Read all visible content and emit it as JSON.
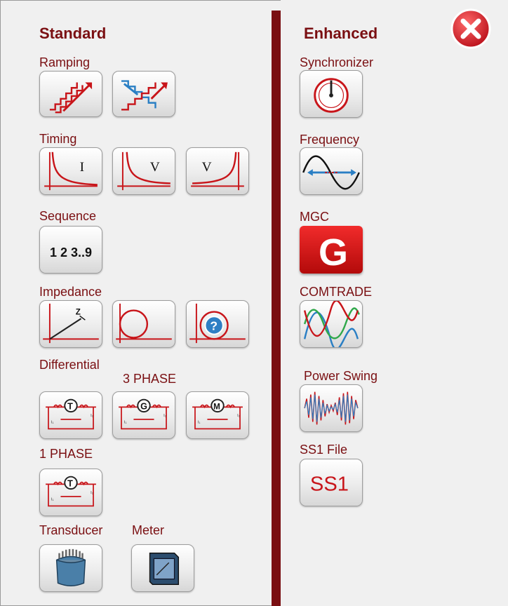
{
  "standard": {
    "heading": "Standard",
    "ramping": {
      "label": "Ramping",
      "buttons": [
        "ramp-up-icon",
        "ramp-pulse-icon"
      ]
    },
    "timing": {
      "label": "Timing",
      "buttons": [
        {
          "icon": "timing-current-curve-icon",
          "letter": "I"
        },
        {
          "icon": "timing-voltage-curve-icon",
          "letter": "V"
        },
        {
          "icon": "timing-overvoltage-curve-icon",
          "letter": "V"
        }
      ]
    },
    "sequence": {
      "label": "Sequence",
      "button_text": "1 2 3..9"
    },
    "impedance": {
      "label": "Impedance",
      "z_letter": "Z",
      "buttons": [
        "impedance-ramp-icon",
        "impedance-circle-icon",
        "impedance-search-icon"
      ]
    },
    "differential": {
      "label": "Differential",
      "three_phase_label": "3 PHASE",
      "one_phase_label": "1 PHASE",
      "buttons": [
        {
          "letter": "T"
        },
        {
          "letter": "G"
        },
        {
          "letter": "M"
        }
      ],
      "one_phase_button": {
        "letter": "T"
      }
    },
    "transducer": {
      "label": "Transducer"
    },
    "meter": {
      "label": "Meter"
    }
  },
  "enhanced": {
    "heading": "Enhanced",
    "synchronizer": {
      "label": "Synchronizer"
    },
    "frequency": {
      "label": "Frequency"
    },
    "mgc": {
      "label": "MGC",
      "letter": "G"
    },
    "comtrade": {
      "label": "COMTRADE"
    },
    "power_swing": {
      "label": "Power Swing"
    },
    "ss1_file": {
      "label": "SS1 File",
      "button_text": "SS1"
    }
  },
  "colors": {
    "accent": "#7a0f12",
    "curve": "#c8151a",
    "close": "#d61f2c"
  }
}
